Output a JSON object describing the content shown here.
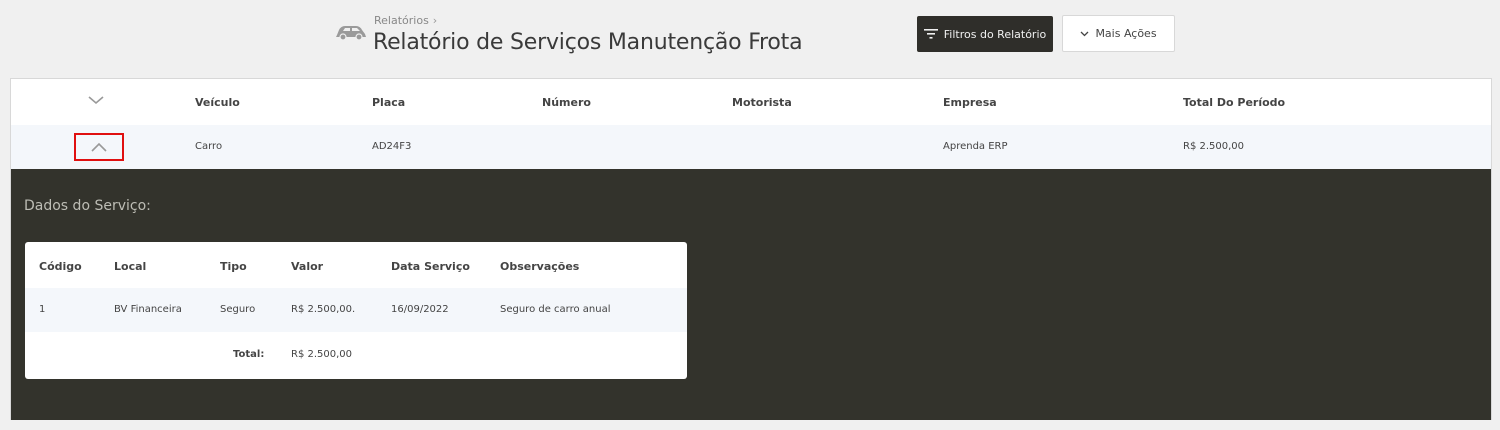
{
  "header": {
    "breadcrumb": "Relatórios",
    "title": "Relatório de Serviços Manutenção Frota",
    "filters_button": "Filtros do Relatório",
    "more_actions_button": "Mais Ações"
  },
  "table": {
    "columns": [
      "Veículo",
      "Placa",
      "Número",
      "Motorista",
      "Empresa",
      "Total Do Período"
    ],
    "rows": [
      {
        "veiculo": "Carro",
        "placa": "AD24F3",
        "numero": "",
        "motorista": "",
        "empresa": "Aprenda ERP",
        "total": "R$ 2.500,00"
      }
    ]
  },
  "detail": {
    "title": "Dados do Serviço:",
    "columns": [
      "Código",
      "Local",
      "Tipo",
      "Valor",
      "Data Serviço",
      "Observações"
    ],
    "rows": [
      {
        "codigo": "1",
        "local": "BV Financeira",
        "tipo": "Seguro",
        "valor": "R$ 2.500,00.",
        "data": "16/09/2022",
        "observacoes": "Seguro de carro anual"
      }
    ],
    "total_label": "Total:",
    "total_value": "R$ 2.500,00"
  },
  "colors": {
    "dark": "#33332c",
    "button_dark": "#2f2e2a",
    "row_bg": "#f4f7fb",
    "highlight": "#e01010"
  }
}
